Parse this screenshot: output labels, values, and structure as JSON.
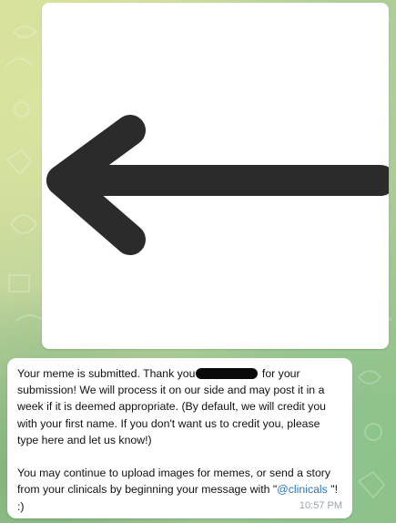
{
  "chat": {
    "messages": [
      {
        "type": "image",
        "alt": "left arrow image"
      },
      {
        "type": "text",
        "part1": "Your meme is submitted. Thank you",
        "part2": " for your submission! We will process it on our side and may post it in a week if it is deemed appropriate. (By default, we will credit you with your first name. If you don't want us to credit you, please type here and let us know!)",
        "part3": "\n\nYou may continue to upload images for memes, or send a story from your clinicals by beginning your message with \"",
        "mention": "@clinicals",
        "part4": " \"! :)",
        "time": "10:57 PM"
      }
    ]
  },
  "colors": {
    "bubble": "#ffffff",
    "link": "#2b76bd",
    "timestamp": "#9aa4ad",
    "arrow": "#2b2b2b",
    "text": "#111111"
  },
  "icons": {
    "image_arrow": "left-arrow-icon"
  }
}
